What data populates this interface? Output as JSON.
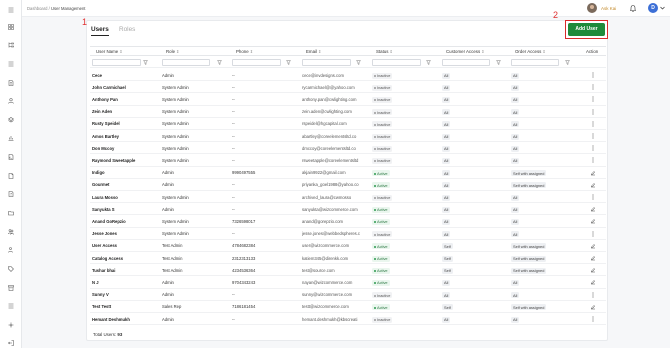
{
  "breadcrumb": {
    "root": "Dashboard",
    "separator": "/",
    "current": "User Management"
  },
  "header": {
    "user_name": "Ask Kai",
    "avatar_initial": "D"
  },
  "sidebar": {
    "icons": [
      "menu-icon",
      "dashboard-icon",
      "hierarchy-icon",
      "list-icon",
      "document-icon",
      "user-icon",
      "layers-icon",
      "chart-icon",
      "document-search-icon",
      "file-icon",
      "file-search-icon",
      "folder-icon",
      "users-group-icon",
      "user-key-icon",
      "tag-icon",
      "archive-icon",
      "grid-icon",
      "settings-icon",
      "logout-icon"
    ]
  },
  "tabs": {
    "users": "Users",
    "roles": "Roles"
  },
  "annotations": {
    "mark1": "1",
    "mark2": "2"
  },
  "add_user_label": "Add User",
  "columns": [
    "User Name",
    "Role",
    "Phone",
    "Email",
    "Status",
    "Customer Access",
    "Order Access",
    "Action"
  ],
  "rows": [
    {
      "name": "Cece",
      "role": "Admin",
      "phone": "--",
      "email": "cece@invdesigns.com",
      "status": "Inactive",
      "customer": "All",
      "order": "All",
      "action": "more"
    },
    {
      "name": "John Carmichael",
      "role": "System Admin",
      "phone": "--",
      "email": "rycarmichael@@yahoo.com",
      "status": "Inactive",
      "customer": "All",
      "order": "All",
      "action": "more"
    },
    {
      "name": "Anthony Pan",
      "role": "System Admin",
      "phone": "--",
      "email": "anthony.pan@cwlighting.com",
      "status": "Inactive",
      "customer": "All",
      "order": "All",
      "action": "more"
    },
    {
      "name": "Zein Aden",
      "role": "System Admin",
      "phone": "--",
      "email": "zein.aden@cwlighting.com",
      "status": "Inactive",
      "customer": "All",
      "order": "All",
      "action": "more"
    },
    {
      "name": "Rusty Speidel",
      "role": "System Admin",
      "phone": "--",
      "email": "rspeidel@hgcapital.com",
      "status": "Inactive",
      "customer": "All",
      "order": "All",
      "action": "more"
    },
    {
      "name": "Amos Bartley",
      "role": "System Admin",
      "phone": "--",
      "email": "abartley@coreelementsltd.co",
      "status": "Inactive",
      "customer": "All",
      "order": "All",
      "action": "more"
    },
    {
      "name": "Don Mccoy",
      "role": "System Admin",
      "phone": "--",
      "email": "dmccoy@coreelementsltd.co",
      "status": "Inactive",
      "customer": "All",
      "order": "All",
      "action": "more"
    },
    {
      "name": "Raymond Sweetapple",
      "role": "System Admin",
      "phone": "--",
      "email": "rsweetapple@coreelementsltd",
      "status": "Inactive",
      "customer": "All",
      "order": "All",
      "action": "more"
    },
    {
      "name": "Indigo",
      "role": "Admin",
      "phone": "9990497555",
      "email": "akjain9922@gmail.com",
      "status": "Active",
      "customer": "All",
      "order": "Self with assigned",
      "action": "edit"
    },
    {
      "name": "Gourmet",
      "role": "Admin",
      "phone": "--",
      "email": "priyanka_goel1988@yahoo.co",
      "status": "Active",
      "customer": "All",
      "order": "Self with assigned",
      "action": "edit"
    },
    {
      "name": "Laura Mosso",
      "role": "System Admin",
      "phone": "--",
      "email": "archived_laura@cwmosso",
      "status": "Inactive",
      "customer": "All",
      "order": "All",
      "action": "more"
    },
    {
      "name": "Sanyukta S",
      "role": "Admin",
      "phone": "--",
      "email": "sanyukta@wizcommerce.com",
      "status": "Active",
      "customer": "All",
      "order": "All",
      "action": "edit"
    },
    {
      "name": "Anand GoRepzio",
      "role": "System Admin",
      "phone": "7326598017",
      "email": "anand@gorepzio.com",
      "status": "Active",
      "customer": "All",
      "order": "All",
      "action": "edit"
    },
    {
      "name": "Jesse Jones",
      "role": "System Admin",
      "phone": "--",
      "email": "jesse.jones@webbedspheres.c",
      "status": "Inactive",
      "customer": "All",
      "order": "All",
      "action": "more"
    },
    {
      "name": "User Access",
      "role": "Test Admin",
      "phone": "4784682384",
      "email": "user@wizcommerce.com",
      "status": "Active",
      "customer": "Self",
      "order": "Self with assigned",
      "action": "edit"
    },
    {
      "name": "Catalog Access",
      "role": "Test Admin",
      "phone": "2312313133",
      "email": "katiem345@direnkk.com",
      "status": "Active",
      "customer": "Self",
      "order": "Self with assigned",
      "action": "edit"
    },
    {
      "name": "Tushar bhai",
      "role": "Test Admin",
      "phone": "4234536364",
      "email": "test@source.com",
      "status": "Active",
      "customer": "Self",
      "order": "Self with assigned",
      "action": "edit"
    },
    {
      "name": "N J",
      "role": "Admin",
      "phone": "9704343243",
      "email": "nayan@wizcommerce.com",
      "status": "Active",
      "customer": "All",
      "order": "All",
      "action": "edit"
    },
    {
      "name": "Sunny V",
      "role": "Admin",
      "phone": "--",
      "email": "sunny@wizcommerce.com",
      "status": "Inactive",
      "customer": "All",
      "order": "All",
      "action": "more"
    },
    {
      "name": "Test Testt",
      "role": "Sales Rep",
      "phone": "7186181454",
      "email": "testt@wizcommerce.com",
      "status": "Active",
      "customer": "Self",
      "order": "Self with assigned",
      "action": "edit"
    },
    {
      "name": "Hemant Deshmukh",
      "role": "Admin",
      "phone": "--",
      "email": "hemant.deshmukh@kbscreati",
      "status": "Inactive",
      "customer": "All",
      "order": "All",
      "action": "more"
    }
  ],
  "footer": {
    "label": "Total Users:",
    "count": "93"
  },
  "colors": {
    "accent_green": "#1f8a3a",
    "highlight_red": "#d92b2b",
    "user_name_gold": "#c48a2a",
    "avatar_blue": "#3c6fd6"
  }
}
